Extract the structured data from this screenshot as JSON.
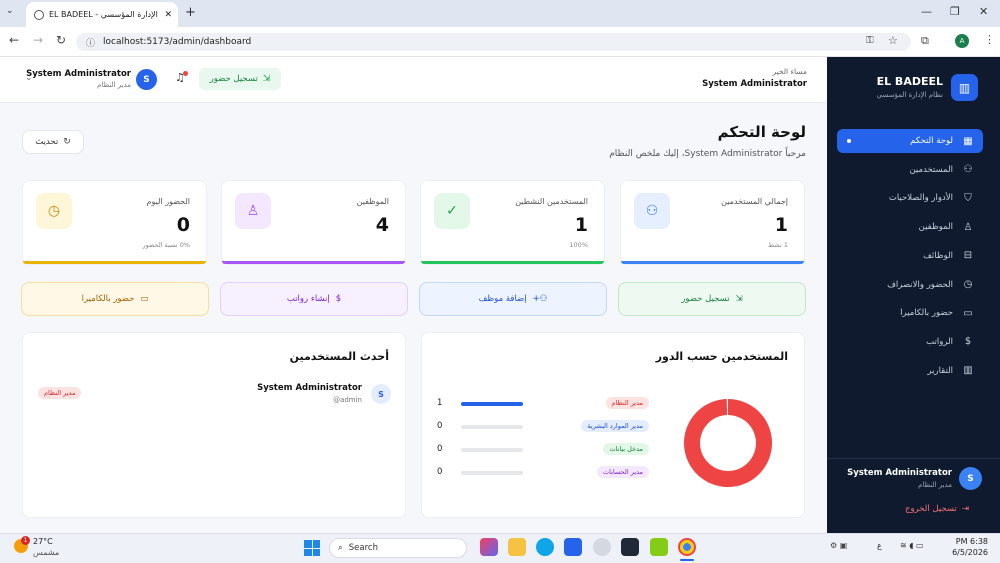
{
  "browser": {
    "tab_title": "EL BADEEL - نظام الإدارة المؤسسي",
    "url": "localhost:5173/admin/dashboard"
  },
  "sidebar": {
    "brand": "EL BADEEL",
    "brand_sub": "نظام الإدارة المؤسسي",
    "items": [
      {
        "label": "لوحة التحكم",
        "icon": "grid-icon",
        "active": true
      },
      {
        "label": "المستخدمين",
        "icon": "users-icon"
      },
      {
        "label": "الأدوار والصلاحيات",
        "icon": "shield-icon"
      },
      {
        "label": "الموظفين",
        "icon": "employees-icon"
      },
      {
        "label": "الوظائف",
        "icon": "briefcase-icon"
      },
      {
        "label": "الحضور والانصراف",
        "icon": "clock-icon"
      },
      {
        "label": "حضور بالكاميرا",
        "icon": "camera-icon"
      },
      {
        "label": "الرواتب",
        "icon": "dollar-icon"
      },
      {
        "label": "التقارير",
        "icon": "chart-icon"
      }
    ],
    "user_name": "System Administrator",
    "user_role": "مدير النظام",
    "avatar_letter": "S",
    "logout": "تسجيل الخروج"
  },
  "header": {
    "greeting": "مساء الخير",
    "greeting_name": "System Administrator",
    "checkin_label": "تسجيل حضور",
    "user_name": "System Administrator",
    "user_role": "مدير النظام",
    "avatar_letter": "S"
  },
  "page": {
    "title": "لوحة التحكم",
    "subtitle": "مرحباً System Administrator، إليك ملخص النظام",
    "refresh_label": "تحديث"
  },
  "stats": [
    {
      "label": "إجمالي المستخدمين",
      "value": "1",
      "sub": "1 نشط",
      "icon": "user-check-icon",
      "color": "#3b82f6"
    },
    {
      "label": "المستخدمين النشطين",
      "value": "1",
      "sub": "100%",
      "icon": "check-circle-icon",
      "color": "#22c55e"
    },
    {
      "label": "الموظفين",
      "value": "4",
      "sub": "",
      "icon": "employee-icon",
      "color": "#a855f7"
    },
    {
      "label": "الحضور اليوم",
      "value": "0",
      "sub": "0% نسبة الحضور",
      "icon": "clock-icon",
      "color": "#eab308"
    }
  ],
  "quick_actions": [
    {
      "label": "تسجيل حضور",
      "icon": "login-icon"
    },
    {
      "label": "إضافة موظف",
      "icon": "user-plus-icon"
    },
    {
      "label": "إنشاء رواتب",
      "icon": "dollar-icon"
    },
    {
      "label": "حضور بالكاميرا",
      "icon": "camera-icon"
    }
  ],
  "roles_card": {
    "title": "المستخدمين حسب الدور",
    "rows": [
      {
        "role": "مدير النظام",
        "count": "1"
      },
      {
        "role": "مدير الموارد البشرية",
        "count": "0"
      },
      {
        "role": "مدخل بيانات",
        "count": "0"
      },
      {
        "role": "مدير الحسابات",
        "count": "0"
      }
    ]
  },
  "chart_data": {
    "type": "pie",
    "categories": [
      "مدير النظام",
      "مدير الموارد البشرية",
      "مدخل بيانات",
      "مدير الحسابات"
    ],
    "values": [
      1,
      0,
      0,
      0
    ],
    "colors": [
      "#ef4444",
      "#3b82f6",
      "#22c55e",
      "#a855f7"
    ]
  },
  "recent_users": {
    "title": "أحدث المستخدمين",
    "items": [
      {
        "name": "System Administrator",
        "username": "admin@",
        "role": "مدير النظام",
        "avatar": "S"
      }
    ]
  },
  "taskbar": {
    "weather_temp": "27°C",
    "weather_desc": "مشمس",
    "weather_badge": "1",
    "search": "Search",
    "time": "6:38 PM",
    "date": "6/5/2026",
    "lang": "ع"
  }
}
